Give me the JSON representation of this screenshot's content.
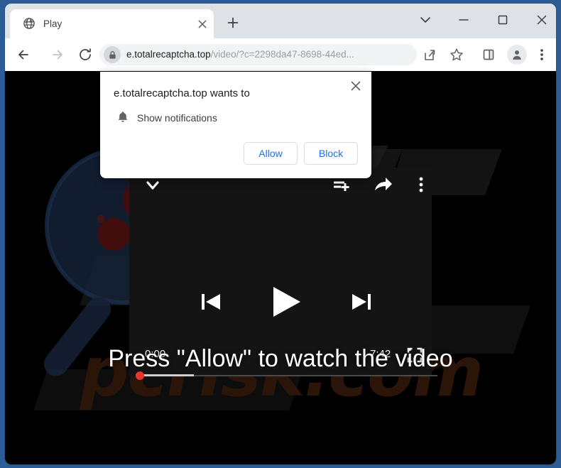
{
  "window": {
    "controls": [
      {
        "name": "tab-search",
        "icon": "chevron-down-icon"
      },
      {
        "name": "minimize",
        "icon": "minimize-icon"
      },
      {
        "name": "maximize",
        "icon": "maximize-icon"
      },
      {
        "name": "close",
        "icon": "close-icon"
      }
    ]
  },
  "tab": {
    "title": "Play",
    "favicon": "globe-icon",
    "close_icon": "close-icon",
    "newtab_icon": "plus-icon"
  },
  "toolbar": {
    "back_icon": "arrow-left-icon",
    "forward_icon": "arrow-right-icon",
    "reload_icon": "reload-icon",
    "share_icon": "share-icon",
    "bookmark_icon": "star-icon",
    "side_panel_icon": "side-panel-icon",
    "avatar_icon": "person-icon",
    "menu_icon": "more-vertical-icon"
  },
  "omnibox": {
    "lock_icon": "lock-icon",
    "host": "e.totalrecaptcha.top",
    "path": "/video/?c=2298da47-8698-44ed...",
    "full_url": "e.totalrecaptcha.top/video/?c=2298da47-8698-44ed..."
  },
  "permission_dialog": {
    "title": "e.totalrecaptcha.top wants to",
    "permission": "Show notifications",
    "permission_icon": "bell-icon",
    "close_icon": "close-icon",
    "allow_label": "Allow",
    "block_label": "Block",
    "accent_color": "#1a73e8"
  },
  "page": {
    "headline": "Press \"Allow\" to watch the video",
    "watermark": "pcrisk.com",
    "background_color": "#000000"
  },
  "player": {
    "collapse_icon": "chevron-down-icon",
    "playlist_add_icon": "playlist-add-icon",
    "share_icon": "share-arrow-icon",
    "more_icon": "more-vertical-icon",
    "previous_icon": "skip-previous-icon",
    "play_icon": "play-icon",
    "next_icon": "skip-next-icon",
    "fullscreen_icon": "fullscreen-icon",
    "time_current": "0:00",
    "time_total": "7:42",
    "progress_percent": 0,
    "buffered_percent": 19,
    "knob_color": "#e8332a",
    "panel_color": "#141414"
  }
}
